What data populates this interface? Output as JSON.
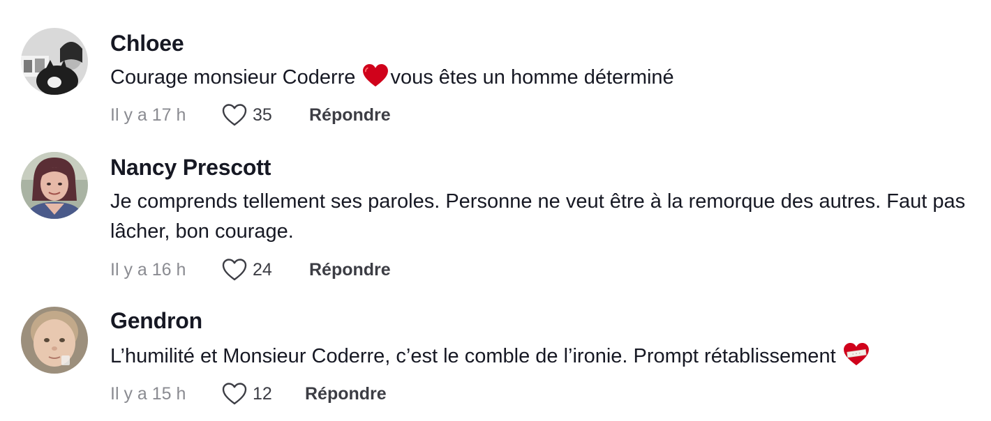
{
  "comments": [
    {
      "username": "Chloee",
      "text_before": "Courage monsieur Coderre ",
      "emoji": "red-heart-icon",
      "text_after": "vous êtes un homme déterminé",
      "time": "Il y a 17 h",
      "likes": "35",
      "reply_label": "Répondre"
    },
    {
      "username": "Nancy Prescott",
      "text_before": "Je comprends tellement ses paroles. Personne ne veut être à la remorque des autres. Faut pas lâcher, bon courage.",
      "time": "Il y a 16 h",
      "likes": "24",
      "reply_label": "Répondre"
    },
    {
      "username": "Gendron",
      "text_before": "L’humilité et Monsieur Coderre, c’est le comble de l’ironie. Prompt rétablissement ",
      "emoji": "mending-heart-icon",
      "time": "Il y a 15 h",
      "likes": "12",
      "reply_label": "Répondre"
    }
  ],
  "colors": {
    "text": "#161823",
    "muted": "#8a8b91",
    "secondary": "#3c3d44",
    "heart_red": "#d0021b"
  }
}
